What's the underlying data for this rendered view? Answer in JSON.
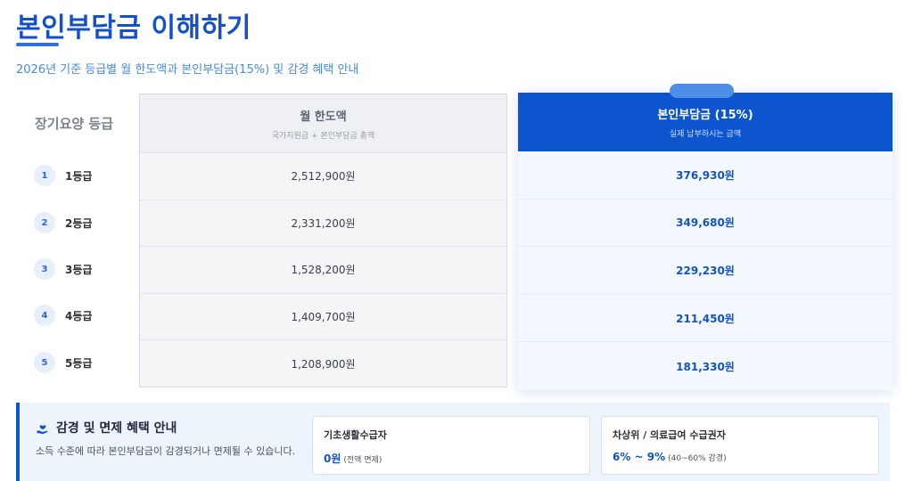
{
  "header": {
    "title": "본인부담금 이해하기",
    "subtitle": "2026년 기준 등급별 월 한도액과 본인부담금(15%) 및 감경 혜택 안내"
  },
  "table": {
    "grade_header": "장기요양 등급",
    "limit_header": "월 한도액",
    "limit_subheader": "국가지원금 + 본인부담금 총액",
    "copay_header": "본인부담금 (15%)",
    "copay_subheader": "실제 납부하시는 금액",
    "rows": [
      {
        "num": "1",
        "grade": "1등급",
        "limit": "2,512,900원",
        "copay": "376,930원"
      },
      {
        "num": "2",
        "grade": "2등급",
        "limit": "2,331,200원",
        "copay": "349,680원"
      },
      {
        "num": "3",
        "grade": "3등급",
        "limit": "1,528,200원",
        "copay": "229,230원"
      },
      {
        "num": "4",
        "grade": "4등급",
        "limit": "1,409,700원",
        "copay": "211,450원"
      },
      {
        "num": "5",
        "grade": "5등급",
        "limit": "1,208,900원",
        "copay": "181,330원"
      }
    ]
  },
  "benefit": {
    "icon": "hand-heart-icon",
    "title": "감경 및 면제 혜택 안내",
    "description": "소득 수준에 따라 본인부담금이 감경되거나 면제될 수 있습니다.",
    "cards": [
      {
        "title": "기초생활수급자",
        "value": "0원",
        "note": "(전액 면제)"
      },
      {
        "title": "차상위 / 의료급여 수급권자",
        "value": "6% ~ 9%",
        "note": "(40~60% 감경)"
      }
    ]
  },
  "colors": {
    "brand": "#0c55cf",
    "title": "#1450c8",
    "accent_text": "#1353c4"
  }
}
